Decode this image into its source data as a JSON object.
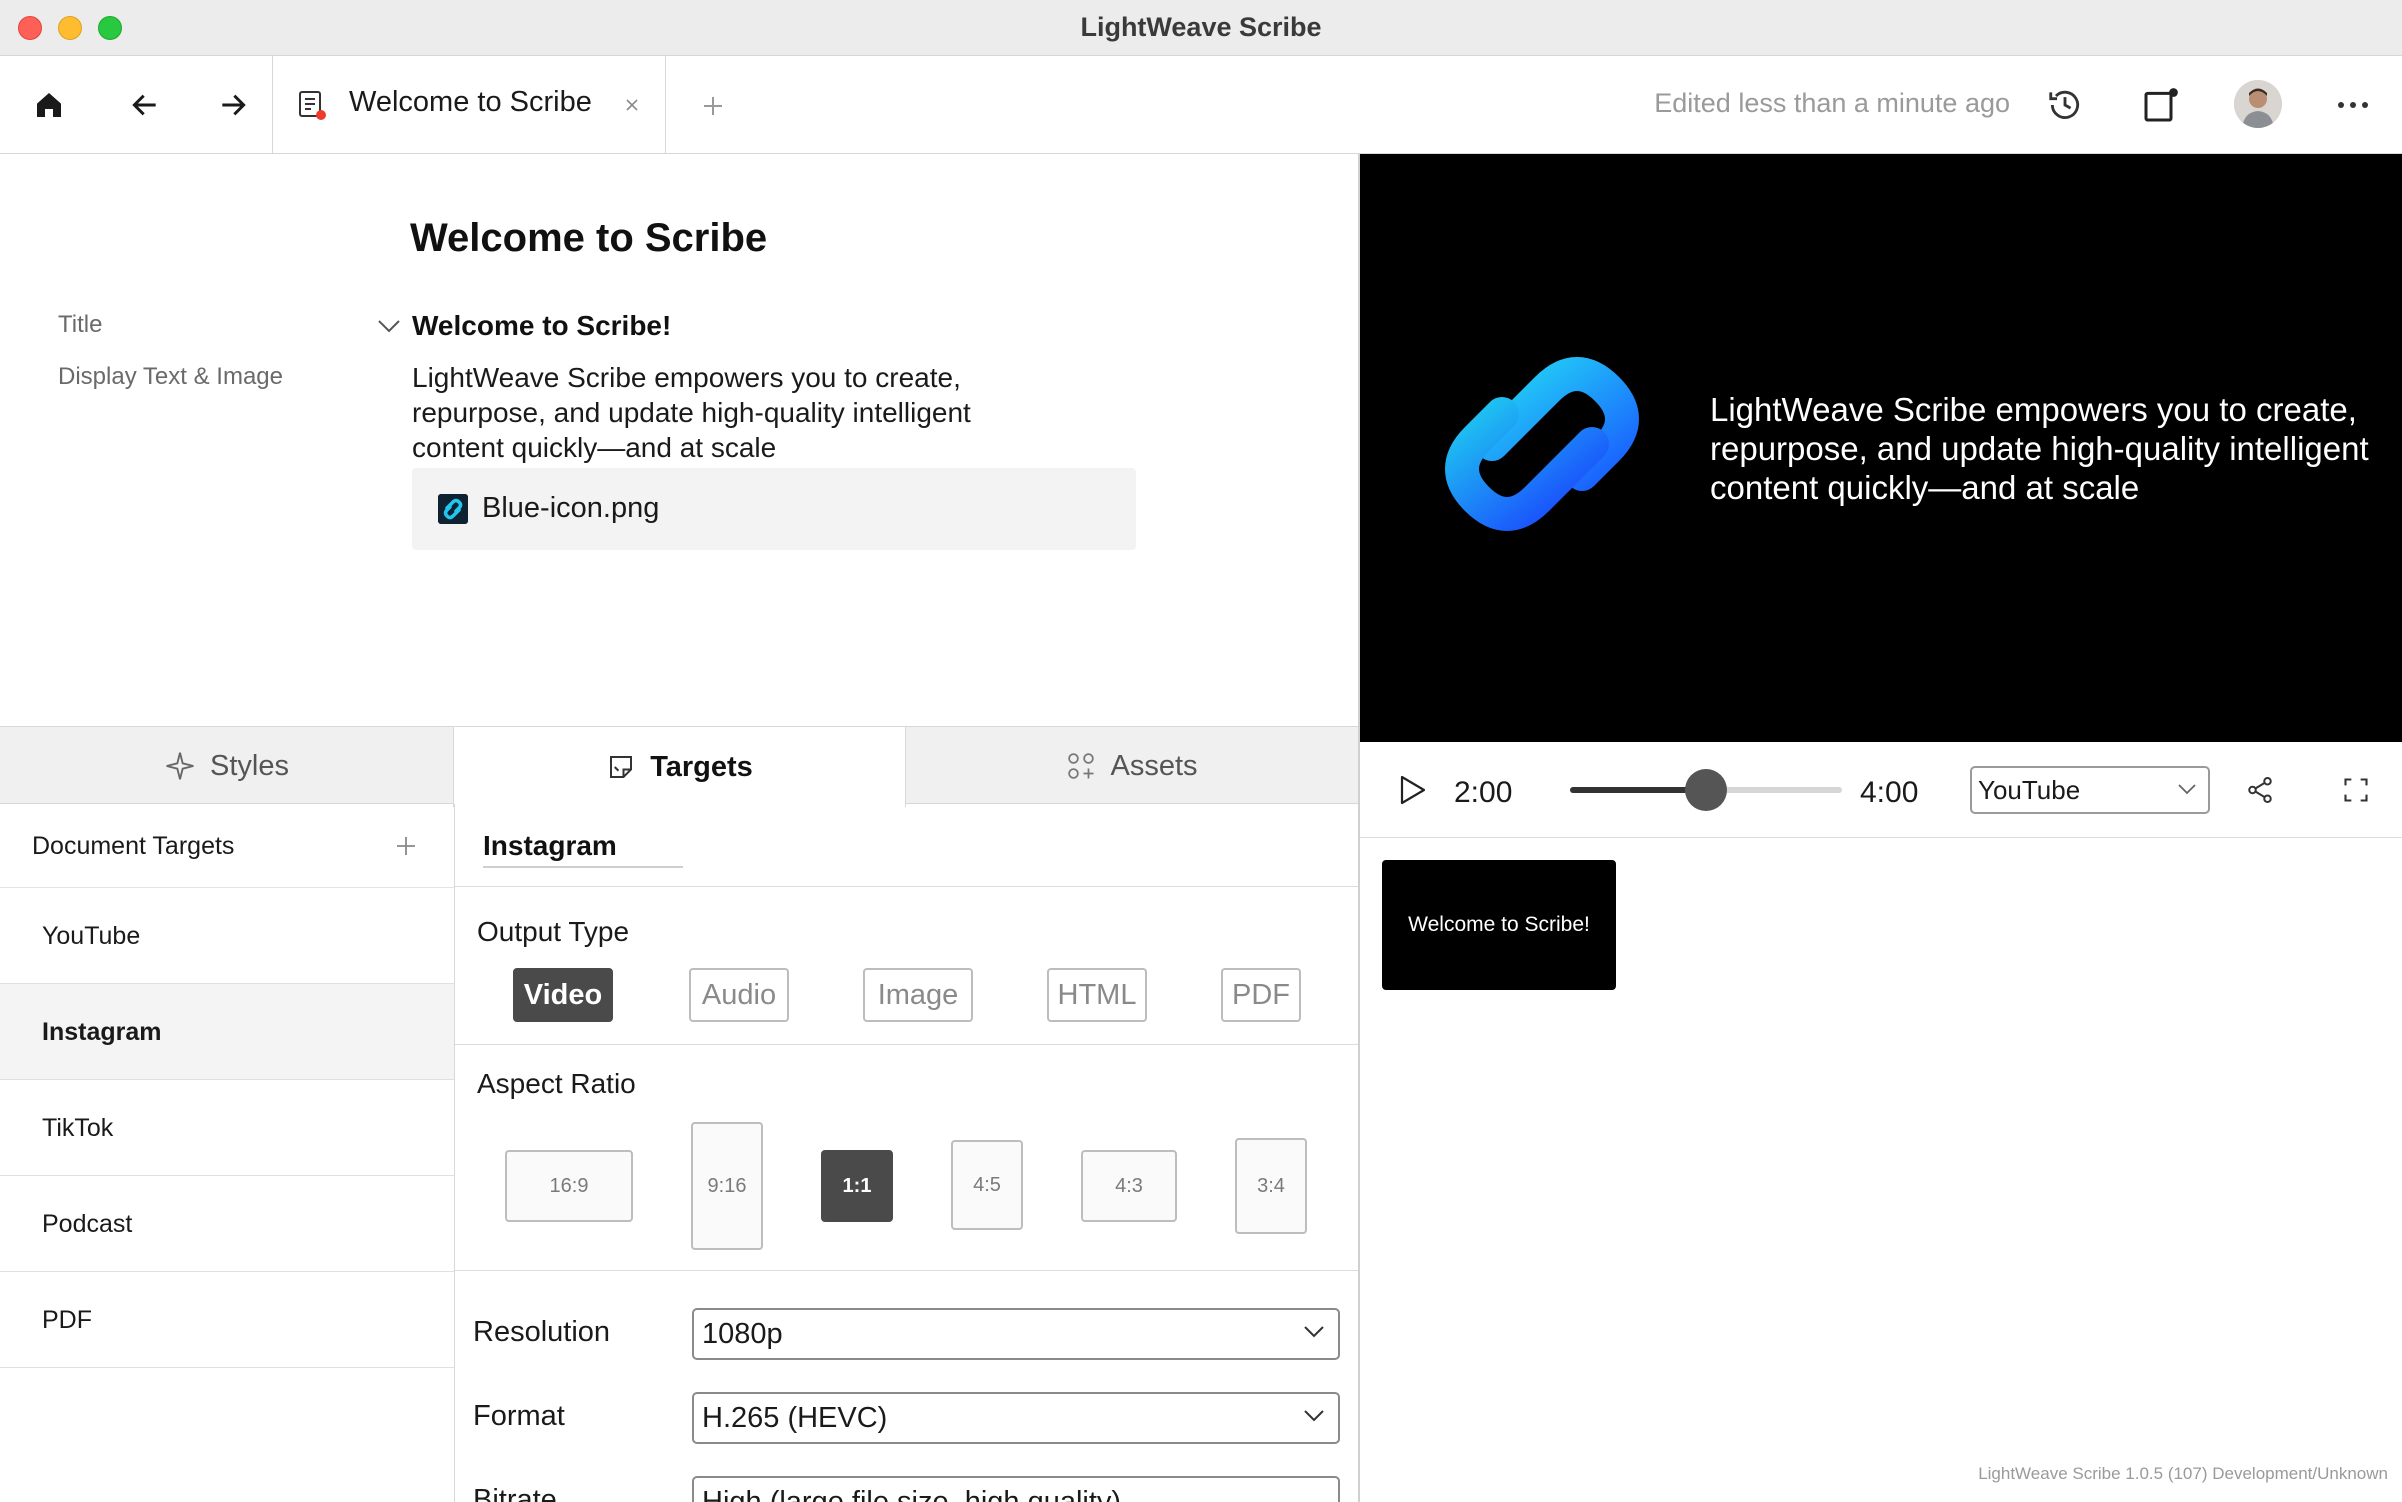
{
  "window": {
    "title": "LightWeave Scribe"
  },
  "toolbar": {
    "tab_label": "Welcome to Scribe",
    "edited_status": "Edited less than a minute ago"
  },
  "document": {
    "title": "Welcome to Scribe",
    "field_labels": [
      "Title",
      "Display Text & Image"
    ],
    "slide_title": "Welcome to Scribe!",
    "slide_text": "LightWeave Scribe empowers you to create, repurpose, and update high-quality intelligent content quickly—and at scale",
    "asset_name": "Blue-icon.png"
  },
  "panel_tabs": [
    {
      "label": "Styles",
      "icon": "sparkle-icon",
      "active": false
    },
    {
      "label": "Targets",
      "icon": "target-note-icon",
      "active": true
    },
    {
      "label": "Assets",
      "icon": "assets-grid-icon",
      "active": false
    }
  ],
  "targets": {
    "header": "Document Targets",
    "items": [
      "YouTube",
      "Instagram",
      "TikTok",
      "Podcast",
      "PDF"
    ],
    "selected": "Instagram"
  },
  "target_settings": {
    "name": "Instagram",
    "output_type_label": "Output Type",
    "output_types": [
      "Video",
      "Audio",
      "Image",
      "HTML",
      "PDF"
    ],
    "output_selected": "Video",
    "aspect_ratio_label": "Aspect Ratio",
    "aspect_ratios": [
      "16:9",
      "9:16",
      "1:1",
      "4:5",
      "4:3",
      "3:4"
    ],
    "aspect_selected": "1:1",
    "resolution_label": "Resolution",
    "resolution_value": "1080p",
    "format_label": "Format",
    "format_value": "H.265 (HEVC)",
    "bitrate_label": "Bitrate",
    "bitrate_value": "High (large file size, high quality)"
  },
  "preview": {
    "text": "LightWeave Scribe empowers you to create, repurpose, and update high-quality intelligent content quickly—and at scale",
    "current_time": "2:00",
    "total_time": "4:00",
    "progress": 0.5,
    "target_value": "YouTube",
    "slide_thumb_label": "Welcome to Scribe!"
  },
  "footer": {
    "version": "LightWeave Scribe 1.0.5 (107) Development/Unknown"
  },
  "colors": {
    "accent_active": "#4a4a4a",
    "close": "#fe5f57",
    "minimize": "#febc2e",
    "maximize": "#28c840",
    "logo_cyan": "#1ec8f0",
    "logo_blue": "#1a5cff"
  }
}
